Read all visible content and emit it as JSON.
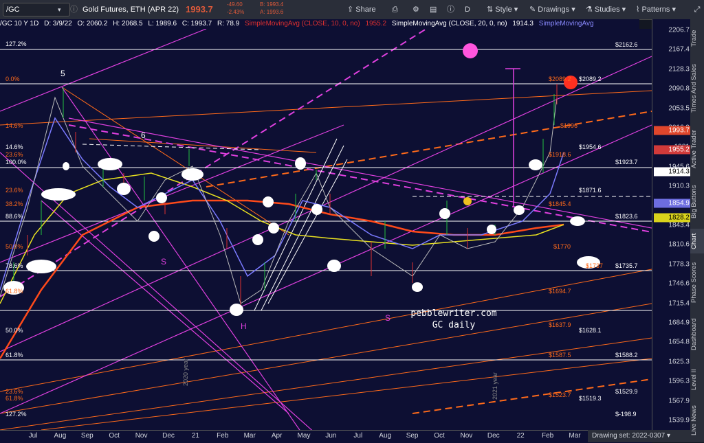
{
  "topbar": {
    "symbol": "/GC",
    "title": "Gold Futures, ETH (APR 22)",
    "price": "1993.7",
    "change": "-49.60",
    "change_pct": "-2.43%",
    "bid": "B: 1993.4",
    "ask": "A: 1993.6",
    "interval": "D",
    "share_label": "Share",
    "style_label": "Style",
    "drawings_label": "Drawings",
    "studies_label": "Studies",
    "patterns_label": "Patterns"
  },
  "statline": {
    "symbol": "/GC 10 Y 1D",
    "date": "D: 3/9/22",
    "open": "O: 2060.2",
    "high": "H: 2068.5",
    "low": "L: 1989.6",
    "close": "C: 1993.7",
    "range": "R: 78.9",
    "sma10": "SimpleMovingAvg (CLOSE, 10, 0, no)",
    "sma10_val": "1955.2",
    "sma20": "SimpleMovingAvg (CLOSE, 20, 0, no)",
    "sma20_val": "1914.3",
    "sma_next": "SimpleMovingAvg"
  },
  "yaxis": {
    "ticks": [
      "2206.7",
      "2167.4",
      "2128.3",
      "2090.8",
      "2053.5",
      "2016.9",
      "1981",
      "1945.6",
      "1910.3",
      "1876.9",
      "1843.4",
      "1810.6",
      "1778.3",
      "1746.6",
      "1715.4",
      "1684.9",
      "1654.8",
      "1625.3",
      "1596.3",
      "1567.9",
      "1539.9",
      "1512.5"
    ],
    "badges": [
      {
        "label": "1993.7",
        "color": "#e0462c"
      },
      {
        "label": "1955.2",
        "color": "#d13a3a"
      },
      {
        "label": "1914.3",
        "color": "#ffffff"
      },
      {
        "label": "1854.9",
        "color": "#6d6de0"
      },
      {
        "label": "1828.2",
        "color": "#d9d21c"
      }
    ]
  },
  "xaxis": {
    "ticks": [
      "Jul",
      "Aug",
      "Sep",
      "Oct",
      "Nov",
      "Dec",
      "21",
      "Feb",
      "Mar",
      "Apr",
      "May",
      "Jun",
      "Jul",
      "Aug",
      "Sep",
      "Oct",
      "Nov",
      "Dec",
      "22",
      "Feb",
      "Mar",
      "Apr",
      "May",
      "Jun"
    ]
  },
  "drawing_set": "Drawing set: 2022-0307",
  "right_panel": [
    "Trade",
    "Times And Sales",
    "Active Trader",
    "Big Buttons",
    "Chart",
    "Phase Scores",
    "Dashboard",
    "Level II",
    "Live News"
  ],
  "fib_left": [
    "127.2%",
    "0.0%",
    "14.6%",
    "14.6%",
    "23.6%",
    "100.0%",
    "23.6%",
    "38.2%",
    "88.6%",
    "50.0%",
    "78.6%",
    "61.8%",
    "50.0%",
    "61.8%",
    "23.6%",
    "61.8%",
    "127.2%"
  ],
  "levels_white": [
    "$2162.6",
    "$2089.2",
    "$1954.6",
    "$1923.7",
    "$1871.6",
    "$1823.6",
    "$1735.7",
    "$1628.1",
    "$1588.2",
    "$1529.9",
    "$1519.3",
    "$-198.9"
  ],
  "levels_orange": [
    "$2089.2",
    "$1996",
    "$1918.6",
    "$1845.4",
    "$1770",
    "$1737",
    "$1694.7",
    "$1637.9",
    "$1587.5",
    "$1523.7"
  ],
  "labels": {
    "wave5": "5",
    "wave6": "6",
    "s1": "S",
    "h": "H",
    "s2": "S",
    "year2020": "2020 year",
    "year2021": "2021 year"
  },
  "watermark": {
    "line1": "pebblewriter.com",
    "line2": "GC daily"
  },
  "colors": {
    "bg": "#0d0f33",
    "orange": "#ff6a1a",
    "magenta": "#e040e0",
    "yellow": "#e8e020",
    "white": "#ffffff"
  }
}
